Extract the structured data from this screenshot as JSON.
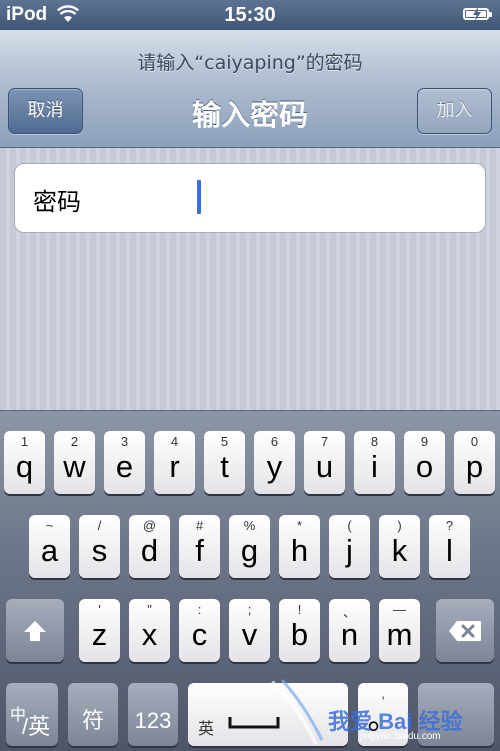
{
  "status_bar": {
    "carrier": "iPod",
    "time": "15:30",
    "battery_percent": 100
  },
  "nav": {
    "prompt": "请输入“caiyaping”的密码",
    "title": "输入密码",
    "cancel_label": "取消",
    "join_label": "加入"
  },
  "form": {
    "password_label": "密码",
    "password_value": ""
  },
  "keyboard": {
    "row1": [
      {
        "sup": "1",
        "main": "q"
      },
      {
        "sup": "2",
        "main": "w"
      },
      {
        "sup": "3",
        "main": "e"
      },
      {
        "sup": "4",
        "main": "r"
      },
      {
        "sup": "5",
        "main": "t"
      },
      {
        "sup": "6",
        "main": "y"
      },
      {
        "sup": "7",
        "main": "u"
      },
      {
        "sup": "8",
        "main": "i"
      },
      {
        "sup": "9",
        "main": "o"
      },
      {
        "sup": "0",
        "main": "p"
      }
    ],
    "row2": [
      {
        "sup": "~",
        "main": "a"
      },
      {
        "sup": "/",
        "main": "s"
      },
      {
        "sup": "@",
        "main": "d"
      },
      {
        "sup": "#",
        "main": "f"
      },
      {
        "sup": "%",
        "main": "g"
      },
      {
        "sup": "*",
        "main": "h"
      },
      {
        "sup": "(",
        "main": "j"
      },
      {
        "sup": ")",
        "main": "k"
      },
      {
        "sup": "?",
        "main": "l"
      }
    ],
    "row3": [
      {
        "sup": "'",
        "main": "z"
      },
      {
        "sup": "\"",
        "main": "x"
      },
      {
        "sup": ":",
        "main": "c"
      },
      {
        "sup": ";",
        "main": "v"
      },
      {
        "sup": "!",
        "main": "b"
      },
      {
        "sup": "、",
        "main": "n"
      },
      {
        "sup": "—",
        "main": "m"
      }
    ],
    "bottom": {
      "lang_sup": "中",
      "lang_main": "/英",
      "symbol_label": "符",
      "number_label": "123",
      "space_label": "英",
      "comma_sup": ",",
      "comma_main": "。"
    }
  },
  "watermark": {
    "brand": "我爱 Bai 经验",
    "url": "jingyan.baidu.com"
  }
}
